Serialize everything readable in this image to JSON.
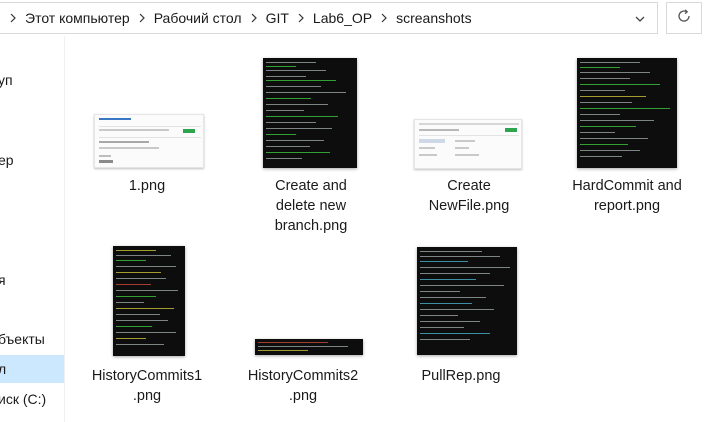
{
  "address_bar": {
    "breadcrumbs": [
      "Этот компьютер",
      "Рабочий стол",
      "GIT",
      "Lab6_OP",
      "screanshots"
    ]
  },
  "nav_pane": {
    "items": [
      {
        "label": "уп",
        "selected": false
      },
      {
        "label": "ер",
        "selected": false
      },
      {
        "label": "я",
        "selected": false
      },
      {
        "label": "бъекты",
        "selected": false
      },
      {
        "label": "л",
        "selected": true
      },
      {
        "label": "иск (C:)",
        "selected": false
      }
    ]
  },
  "files": [
    {
      "name_lines": [
        "1.png"
      ],
      "thumb_style": "light"
    },
    {
      "name_lines": [
        "Create and",
        "delete new",
        "branch.png"
      ],
      "thumb_style": "dark"
    },
    {
      "name_lines": [
        "Create",
        "NewFile.png"
      ],
      "thumb_style": "light"
    },
    {
      "name_lines": [
        "HardCommit and",
        "report.png"
      ],
      "thumb_style": "dark"
    },
    {
      "name_lines": [
        "HistoryCommits1",
        ".png"
      ],
      "thumb_style": "dark"
    },
    {
      "name_lines": [
        "HistoryCommits2",
        ".png"
      ],
      "thumb_style": "dark"
    },
    {
      "name_lines": [
        "PullRep.png"
      ],
      "thumb_style": "dark"
    }
  ],
  "colors": {
    "selection": "#cce8ff",
    "border": "#d9d9d9",
    "terminal_bg": "#0d0d0d",
    "terminal_green": "#3cc63c"
  }
}
